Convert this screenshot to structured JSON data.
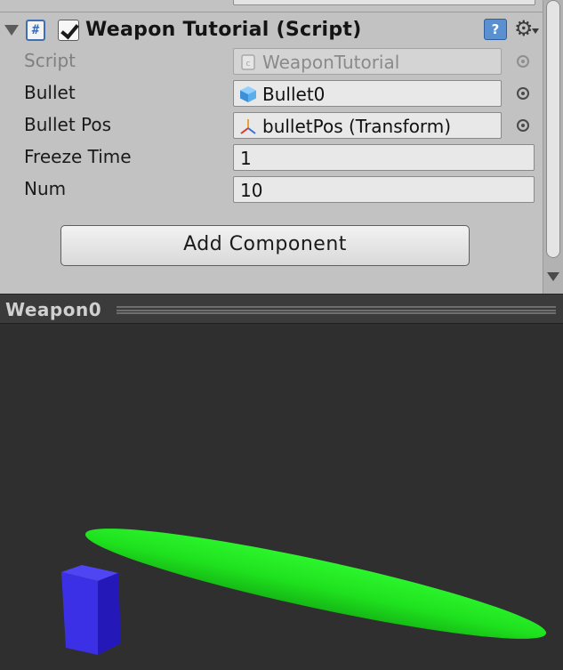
{
  "component": {
    "title": "Weapon Tutorial (Script)",
    "enabled": true,
    "icon": "cs-script-icon",
    "help_icon_glyph": "?",
    "gear_icon_glyph": "⚙"
  },
  "fields": {
    "script": {
      "label": "Script",
      "value": "WeaponTutorial"
    },
    "bullet": {
      "label": "Bullet",
      "value": "Bullet0"
    },
    "bullet_pos": {
      "label": "Bullet Pos",
      "value": "bulletPos (Transform)"
    },
    "freeze_time": {
      "label": "Freeze Time",
      "value": "1"
    },
    "num": {
      "label": "Num",
      "value": "10"
    }
  },
  "add_component_label": "Add Component",
  "preview": {
    "title": "Weapon0",
    "objects": [
      {
        "name": "bullet-capsule",
        "color": "#22ee22"
      },
      {
        "name": "weapon-cube",
        "color": "#3a2ee0"
      }
    ]
  },
  "colors": {
    "inspector_bg": "#c2c2c2",
    "preview_bg": "#2f2f2f",
    "capsule": "#22ee22",
    "cube": "#3a2ee0"
  }
}
